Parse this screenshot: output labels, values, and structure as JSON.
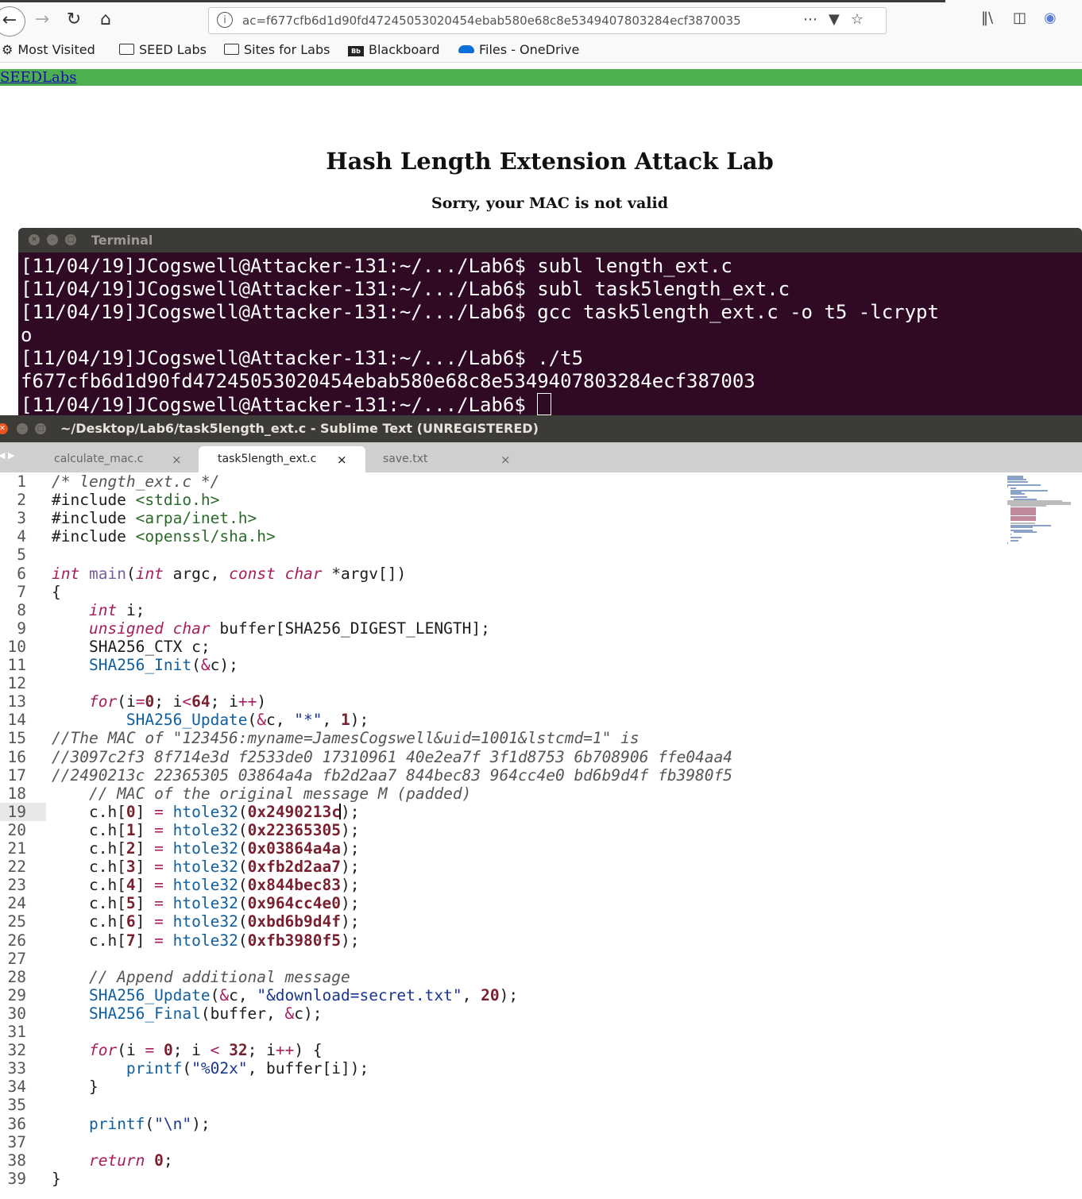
{
  "browser": {
    "url": "ac=f677cfb6d1d90fd47245053020454ebab580e68c8e5349407803284ecf3870035",
    "bookmarks": [
      "Most Visited",
      "SEED Labs",
      "Sites for Labs",
      "Blackboard",
      "Files - OneDrive"
    ]
  },
  "page": {
    "nav_link": "SEEDLabs",
    "title": "Hash Length Extension Attack Lab",
    "message": "Sorry, your MAC is not valid"
  },
  "terminal": {
    "title": "Terminal",
    "lines": [
      "[11/04/19]JCogswell@Attacker-131:~/.../Lab6$ subl length_ext.c",
      "[11/04/19]JCogswell@Attacker-131:~/.../Lab6$ subl task5length_ext.c",
      "[11/04/19]JCogswell@Attacker-131:~/.../Lab6$ gcc task5length_ext.c -o t5 -lcrypt",
      "o",
      "[11/04/19]JCogswell@Attacker-131:~/.../Lab6$ ./t5",
      "f677cfb6d1d90fd47245053020454ebab580e68c8e5349407803284ecf387003",
      "[11/04/19]JCogswell@Attacker-131:~/.../Lab6$ "
    ]
  },
  "editor": {
    "window_title": "~/Desktop/Lab6/task5length_ext.c - Sublime Text (UNREGISTERED)",
    "tabs": [
      "calculate_mac.c",
      "task5length_ext.c",
      "save.txt"
    ],
    "active_tab": "task5length_ext.c",
    "current_line": 19,
    "code_lines": [
      "/* length_ext.c */",
      "#include <stdio.h>",
      "#include <arpa/inet.h>",
      "#include <openssl/sha.h>",
      "",
      "int main(int argc, const char *argv[])",
      "{",
      "    int i;",
      "    unsigned char buffer[SHA256_DIGEST_LENGTH];",
      "    SHA256_CTX c;",
      "    SHA256_Init(&c);",
      "",
      "    for(i=0; i<64; i++)",
      "        SHA256_Update(&c, \"*\", 1);",
      "//The MAC of \"123456:myname=JamesCogswell&uid=1001&lstcmd=1\" is",
      "//3097c2f3 8f714e3d f2533de0 17310961 40e2ea7f 3f1d8753 6b708906 ffe04aa4",
      "//2490213c 22365305 03864a4a fb2d2aa7 844bec83 964cc4e0 bd6b9d4f fb3980f5",
      "    // MAC of the original message M (padded)",
      "    c.h[0] = htole32(0x2490213c);",
      "    c.h[1] = htole32(0x22365305);",
      "    c.h[2] = htole32(0x03864a4a);",
      "    c.h[3] = htole32(0xfb2d2aa7);",
      "    c.h[4] = htole32(0x844bec83);",
      "    c.h[5] = htole32(0x964cc4e0);",
      "    c.h[6] = htole32(0xbd6b9d4f);",
      "    c.h[7] = htole32(0xfb3980f5);",
      "",
      "    // Append additional message",
      "    SHA256_Update(&c, \"&download=secret.txt\", 20);",
      "    SHA256_Final(buffer, &c);",
      "",
      "    for(i = 0; i < 32; i++) {",
      "        printf(\"%02x\", buffer[i]);",
      "    }",
      "",
      "    printf(\"\\n\");",
      "",
      "    return 0;",
      "}"
    ]
  }
}
